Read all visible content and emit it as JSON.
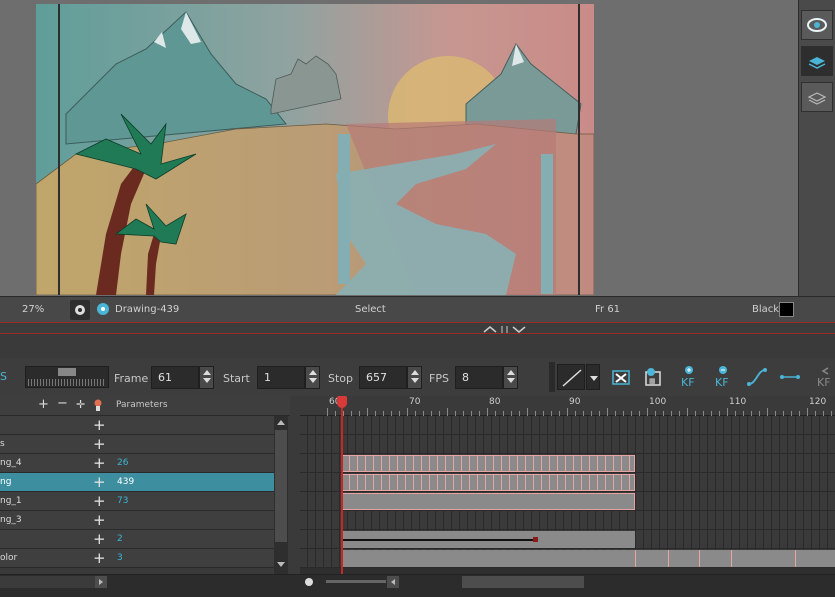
{
  "viewport": {
    "zoom": "27%",
    "drawing_name": "Drawing-439",
    "tool": "Select",
    "frame": "Fr 61",
    "color_name": "Black",
    "color_swatch": "#000000"
  },
  "view_toolbar": {
    "items": [
      "eye-icon",
      "layer-active-icon",
      "layer-inactive-icon"
    ]
  },
  "playback": {
    "frame_label": "Frame",
    "frame_value": "61",
    "start_label": "Start",
    "start_value": "1",
    "stop_label": "Stop",
    "stop_value": "657",
    "fps_label": "FPS",
    "fps_value": "8",
    "edge_glyph": "S"
  },
  "layer_header": {
    "params_label": "Parameters",
    "icons": [
      "add-layer-icon",
      "remove-layer-icon",
      "add-peg-icon",
      "paint-icon"
    ]
  },
  "layers": [
    {
      "name": "",
      "param": ""
    },
    {
      "name": "s",
      "param": ""
    },
    {
      "name": "ng_4",
      "param": "26"
    },
    {
      "name": "ng",
      "param": "439",
      "selected": true
    },
    {
      "name": "ng_1",
      "param": "73"
    },
    {
      "name": "ng_3",
      "param": ""
    },
    {
      "name": "",
      "param": "2"
    },
    {
      "name": "olor",
      "param": "3"
    }
  ],
  "ruler": {
    "ticks": [
      "60",
      "70",
      "80",
      "90",
      "100",
      "110",
      "120"
    ]
  },
  "toolbar_right_icons": [
    "line-style-icon",
    "line-dropdown-icon",
    "create-keyframe-icon",
    "drawing-keyframe-icon",
    "add-keyframe-icon",
    "remove-keyframe-icon",
    "ease-curve-icon",
    "constant-segment-icon",
    "keyframe-left-icon"
  ],
  "kf_label": "KF",
  "colors": {
    "accent": "#3d8fa0",
    "playhead": "#c62828",
    "param_text": "#39b6d6",
    "cell_pink": "#e8a3a3"
  }
}
